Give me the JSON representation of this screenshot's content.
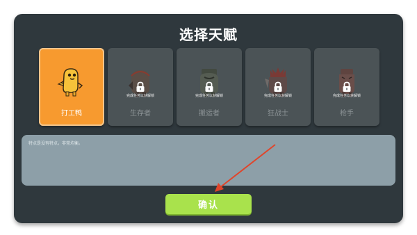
{
  "title": "选择天赋",
  "cards": [
    {
      "label": "打工鸭",
      "selected": true,
      "locked": false,
      "unlock_hint": ""
    },
    {
      "label": "生存者",
      "selected": false,
      "locked": true,
      "unlock_hint": "完成任务以获解锁"
    },
    {
      "label": "搬运者",
      "selected": false,
      "locked": true,
      "unlock_hint": "完成任务以获解锁"
    },
    {
      "label": "狂战士",
      "selected": false,
      "locked": true,
      "unlock_hint": "完成任务以获解锁"
    },
    {
      "label": "枪手",
      "selected": false,
      "locked": true,
      "unlock_hint": "完成任务以获解锁"
    }
  ],
  "description": "特点是没有特点，非常均衡。",
  "confirm_label": "确认",
  "colors": {
    "panel": "#2f383d",
    "selected_card": "#f79a2f",
    "card": "#4b5356",
    "description_box": "#8d9fa8",
    "confirm_button": "#a9e24c",
    "annotation_arrow": "#e0452b"
  },
  "icons": [
    "duck-character-icon",
    "survivor-character-icon",
    "porter-character-icon",
    "berserker-character-icon",
    "gunner-character-icon",
    "lock-icon"
  ]
}
